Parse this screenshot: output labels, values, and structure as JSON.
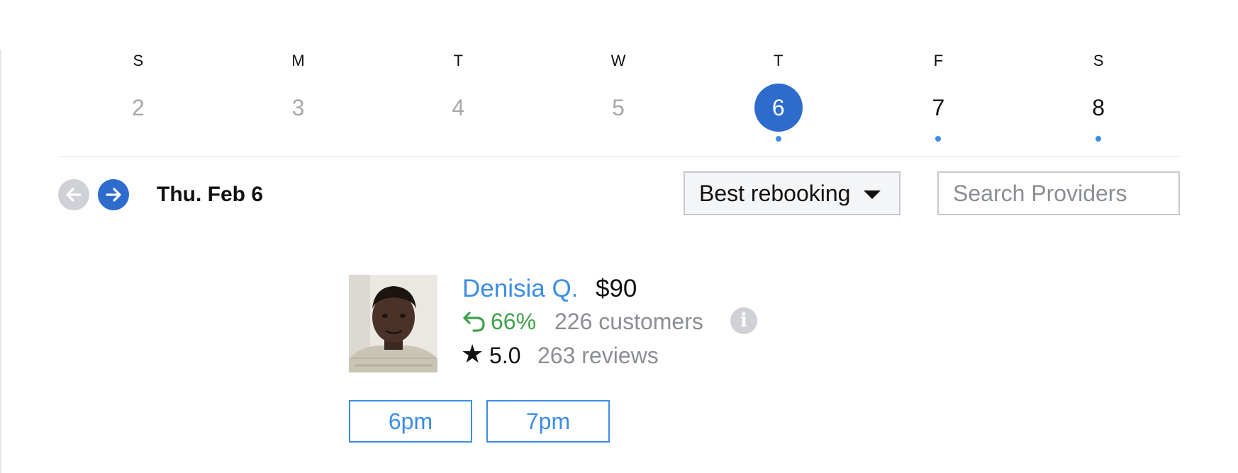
{
  "week": {
    "days": [
      {
        "dow": "S",
        "date": "2",
        "state": "past",
        "has_availability": false
      },
      {
        "dow": "M",
        "date": "3",
        "state": "past",
        "has_availability": false
      },
      {
        "dow": "T",
        "date": "4",
        "state": "past",
        "has_availability": false
      },
      {
        "dow": "W",
        "date": "5",
        "state": "past",
        "has_availability": false
      },
      {
        "dow": "T",
        "date": "6",
        "state": "selected",
        "has_availability": true
      },
      {
        "dow": "F",
        "date": "7",
        "state": "future",
        "has_availability": true
      },
      {
        "dow": "S",
        "date": "8",
        "state": "future",
        "has_availability": true
      }
    ]
  },
  "toolbar": {
    "prev_icon": "arrow-left-icon",
    "next_icon": "arrow-right-icon",
    "current_date": "Thu. Feb 6",
    "sort_selected": "Best rebooking",
    "search_placeholder": "Search Providers"
  },
  "provider": {
    "name": "Denisia Q.",
    "price": "$90",
    "rebooking_rate": "66%",
    "customers": "226 customers",
    "rating": "5.0",
    "reviews": "263 reviews",
    "info_icon_glyph": "i",
    "star_glyph": "★",
    "time_slots": [
      "6pm",
      "7pm"
    ]
  },
  "colors": {
    "accent_blue": "#2d6bcd",
    "link_blue": "#3b8ce8",
    "rebook_green": "#3ea24c",
    "muted_gray": "#8b8e95"
  }
}
